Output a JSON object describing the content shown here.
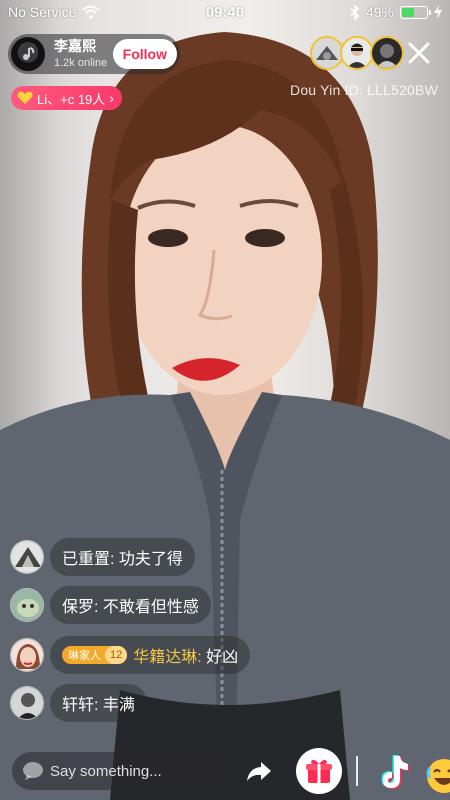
{
  "status_bar": {
    "carrier": "No Service",
    "time": "09:40",
    "battery": "49%",
    "battery_level": 0.49
  },
  "host": {
    "name": "李嘉熙",
    "online": "1.2k online",
    "follow_label": "Follow"
  },
  "fan_badge": {
    "text": "Li、+c 19人"
  },
  "douyin_id": "Dou Yin ID: LLL520BW",
  "comments": [
    {
      "user": "已重置:",
      "text": "功夫了得"
    },
    {
      "user": "保罗:",
      "text": "不敢看但性感"
    },
    {
      "badge": "琳家人",
      "level": "12",
      "user": "华籍达琳:",
      "text": "好凶"
    },
    {
      "user": "轩轩:",
      "text": "丰满"
    }
  ],
  "composer": {
    "placeholder": "Say something..."
  },
  "colors": {
    "brand_pink": "#fe2c55",
    "gold_name": "#f3c847",
    "battery_green": "#4cd964"
  }
}
